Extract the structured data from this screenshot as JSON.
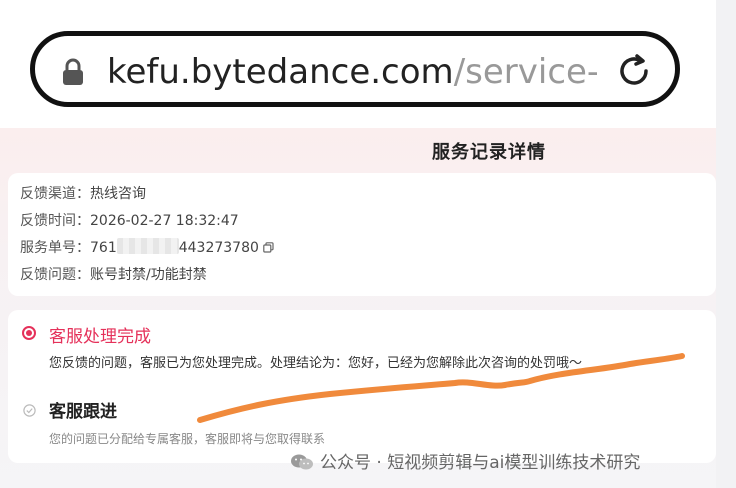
{
  "browser": {
    "url_domain": "kefu.bytedance.com",
    "url_path": "/service-",
    "lock_icon": "lock-icon",
    "reload_icon": "reload-icon"
  },
  "page": {
    "title": "服务记录详情"
  },
  "info": {
    "rows": [
      {
        "label": "反馈渠道：",
        "value": "热线咨询"
      },
      {
        "label": "反馈时间：",
        "value": "2026-02-27 18:32:47"
      },
      {
        "label": "服务单号：",
        "value_prefix": "761",
        "value_suffix": "443273780"
      },
      {
        "label": "反馈问题：",
        "value": "账号封禁/功能封禁"
      }
    ],
    "copy_icon": "copy-icon"
  },
  "progress": {
    "steps": [
      {
        "title": "客服处理完成",
        "desc": "您反馈的问题，客服已为您处理完成。处理结论为：您好，已经为您解除此次咨询的处罚哦～",
        "state": "active"
      },
      {
        "title": "客服跟进",
        "desc": "您的问题已分配给专属客服，客服即将与您取得联系",
        "state": "done"
      }
    ]
  },
  "watermark": {
    "text": "公众号 · 短视频剪辑与ai模型训练技术研究"
  },
  "colors": {
    "accent": "#e5315a",
    "highlight_stroke": "#f08a3c"
  }
}
